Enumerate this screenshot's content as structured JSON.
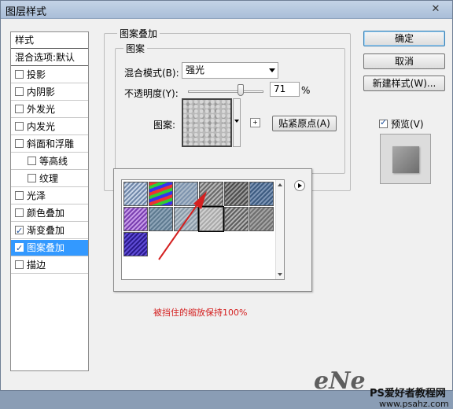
{
  "window": {
    "title": "图层样式",
    "close": "✕"
  },
  "styles_list": {
    "header": "样式",
    "blend_options": "混合选项:默认",
    "items": [
      {
        "label": "投影",
        "checked": false,
        "sub": false
      },
      {
        "label": "内阴影",
        "checked": false,
        "sub": false
      },
      {
        "label": "外发光",
        "checked": false,
        "sub": false
      },
      {
        "label": "内发光",
        "checked": false,
        "sub": false
      },
      {
        "label": "斜面和浮雕",
        "checked": false,
        "sub": false
      },
      {
        "label": "等高线",
        "checked": false,
        "sub": true
      },
      {
        "label": "纹理",
        "checked": false,
        "sub": true
      },
      {
        "label": "光泽",
        "checked": false,
        "sub": false
      },
      {
        "label": "颜色叠加",
        "checked": false,
        "sub": false
      },
      {
        "label": "渐变叠加",
        "checked": true,
        "sub": false
      },
      {
        "label": "图案叠加",
        "checked": true,
        "sub": false,
        "selected": true
      },
      {
        "label": "描边",
        "checked": false,
        "sub": false
      }
    ]
  },
  "pattern_overlay": {
    "group_title": "图案叠加",
    "sub_group_title": "图案",
    "blend_mode_label": "混合模式(B):",
    "blend_mode_value": "强光",
    "opacity_label": "不透明度(Y):",
    "opacity_value": "71",
    "opacity_unit": "%",
    "opacity_level": 0.71,
    "pattern_label": "图案:",
    "snap_button": "贴紧原点(A)"
  },
  "pattern_picker": {
    "menu_icon": "right-arrow-icon",
    "tiles": [
      {
        "name": "bubbles",
        "colors": [
          "#6f86a8",
          "#c8d4e6"
        ]
      },
      {
        "name": "tie-dye",
        "colors": [
          "#e33",
          "#3c3",
          "#33e"
        ]
      },
      {
        "name": "blue-gray",
        "colors": [
          "#7d93ad",
          "#a9b8c8"
        ]
      },
      {
        "name": "woven",
        "colors": [
          "#6b6b6b",
          "#b8b8b8"
        ]
      },
      {
        "name": "dark-rock",
        "colors": [
          "#4c4c4c",
          "#9a9a9a"
        ]
      },
      {
        "name": "blue-denim",
        "colors": [
          "#3d5b80",
          "#7d95b5"
        ]
      },
      {
        "name": "purple-silk",
        "colors": [
          "#7a3fb0",
          "#c69be8"
        ]
      },
      {
        "name": "steel-blue",
        "colors": [
          "#5e7a90",
          "#8ea5b8"
        ]
      },
      {
        "name": "gray-fabric",
        "colors": [
          "#8a9aa8",
          "#b8c4cd"
        ]
      },
      {
        "name": "light-noise",
        "colors": [
          "#a8a8a8",
          "#d0d0d0"
        ],
        "selected": true
      },
      {
        "name": "gray-stripes",
        "colors": [
          "#5e5e5e",
          "#b3b3b3"
        ]
      },
      {
        "name": "gray-grain",
        "colors": [
          "#6f6f6f",
          "#a3a3a3"
        ]
      },
      {
        "name": "blue-purple-silk",
        "colors": [
          "#2a1a8c",
          "#5f4cd6"
        ]
      }
    ]
  },
  "buttons": {
    "ok": "确定",
    "cancel": "取消",
    "new_style": "新建样式(W)...",
    "preview_label": "预览(V)",
    "preview_checked": true
  },
  "annotation": {
    "text": "被挡住的缩放保持100%",
    "color": "#d42020"
  },
  "watermark": {
    "logo": "eNe",
    "text": "PS爱好者教程网",
    "url": "www.psahz.com"
  }
}
